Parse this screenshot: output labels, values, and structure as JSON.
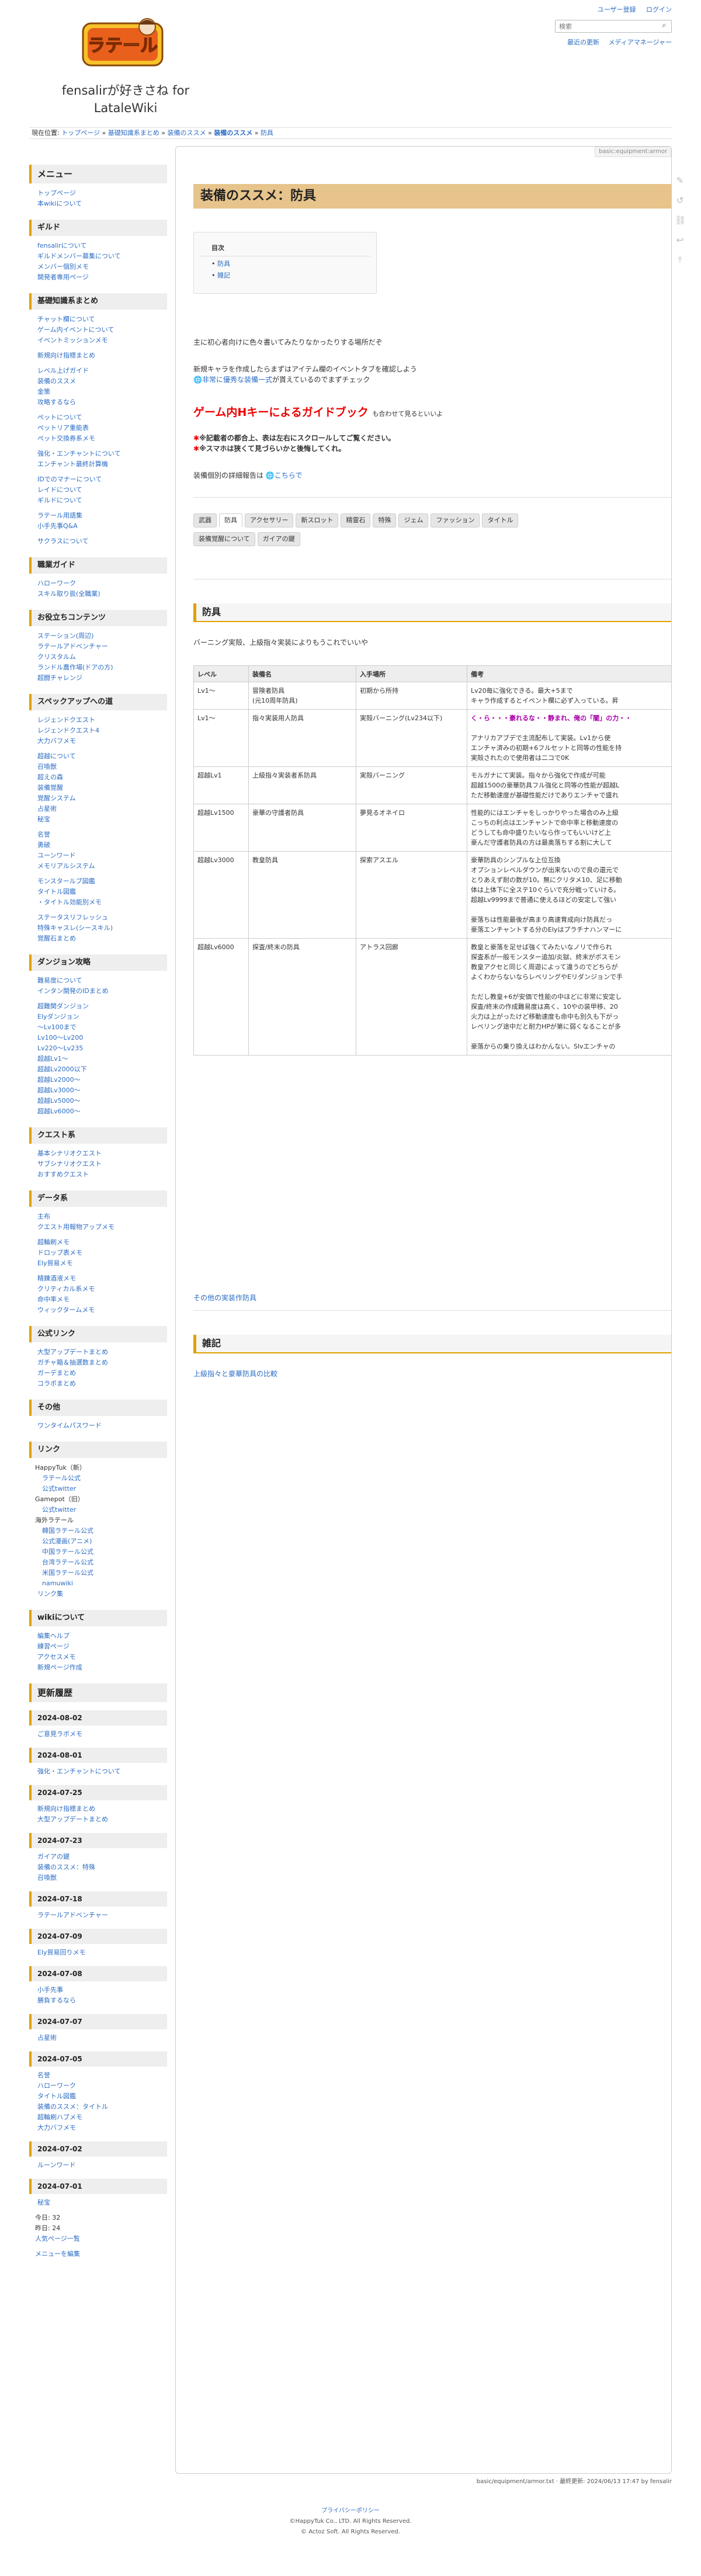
{
  "header": {
    "logo_text": "ラテール",
    "site_title": "fensalirが好きさね for LataleWiki",
    "tools": [
      "ユーザー登録",
      "ログイン"
    ],
    "search_placeholder": "検索",
    "links": [
      "最近の更新",
      "メディアマネージャー"
    ]
  },
  "breadcrumb": {
    "label": "現在位置:",
    "items": [
      "トップページ",
      "基礎知識系まとめ",
      "装備のススメ",
      "装備のススメ",
      "防具"
    ]
  },
  "page": {
    "path": "basic:equipment:armor",
    "title": "装備のススメ：防具",
    "toc": {
      "title": "目次",
      "items": [
        "防具",
        "雑記"
      ]
    },
    "intro1": "主に初心者向けに色々書いてみたりなかったりする場所だぞ",
    "intro2": "新規キャラを作成したらまずはアイテム欄のイベントタブを確認しよう",
    "intro3_link": "非常に優秀な装備一式",
    "intro3_rest": "が貰えているのでまずチェック",
    "guidebook": "ゲーム内Hキーによるガイドブック",
    "guidebook_tail": "も合わせて見るといいよ",
    "notice1": "※記載者の都合上、表は左右にスクロールしてご覧ください。",
    "notice2": "※スマホは狭くて見づらいかと後悔してくれ。",
    "details_prefix": "装備個別の詳細報告は",
    "details_link": "こちらで",
    "tabs_row1": [
      "武器",
      "防具",
      "アクセサリー",
      "新スロット",
      "精霊石",
      "特殊",
      "ジェム",
      "ファッション",
      "タイトル"
    ],
    "tabs_row2": [
      "装備覚醒について",
      "ガイアの鍵"
    ],
    "sec1_title": "防具",
    "sec1_desc": "バーニング実殻、上級指々実装によりもうこれでいいや",
    "table": {
      "headers": [
        "レベル",
        "装備名",
        "入手場所",
        "備考"
      ],
      "rows": [
        {
          "level": [
            "Lv1〜"
          ],
          "name": [
            "冒険者防具",
            "(元10周年防具)"
          ],
          "place": [
            "初期から所持"
          ],
          "note": [
            "Lv20毎に強化できる。最大+5まで",
            "キャラ作成するとイベント欄に必ず入っている。昇"
          ]
        },
        {
          "level": [
            "Lv1〜"
          ],
          "name": [
            "指々実装用人防具"
          ],
          "place": [
            "実殻バーニング(Lv234以下)"
          ],
          "note": [
            "く・ら・・・豪れるな・・静まれ、俺の「闇」の力・・",
            "",
            "アナリカアブデで主流配布して実装。Lv1から使",
            "エンチャ済みの初期+6フルセットと同等の性能を持",
            "実殻されたので使用者は二コで0K"
          ]
        },
        {
          "level": [
            "超越Lv1"
          ],
          "name": [
            "上級指々実装者系防具"
          ],
          "place": [
            "実殻バーニング"
          ],
          "note": [
            "モルガナにて実装。指々から強化で作成が可能",
            "超越1500の豪華防具フル強化と同等の性能が超越L",
            "ただ移動速度が基礎性能だけでありエンチャで盛れ"
          ]
        },
        {
          "level": [
            "超越Lv1500"
          ],
          "name": [
            "豪華の守護者防具"
          ],
          "place": [
            "夢見るオネイロ"
          ],
          "note": [
            "性能的にはエンチャをしっかりやった場合のみ上級",
            "こっちの利点はエンチャントで命中率と移動速度の",
            "どうしても命中盛りたいなら作ってもいいけど上",
            "豪んだ守護者防具の方は最奥落ちする割に大して"
          ]
        },
        {
          "level": [
            "超越Lv3000"
          ],
          "name": [
            "教皇防具"
          ],
          "place": [
            "探索アスエル"
          ],
          "note": [
            "豪華防具のシンプルな上位互換",
            "オプションレベルダウンが出来ないので良の還元で",
            "とりあえず耐の数が10。無にクリタメ10、足に移動",
            "体は上体下に全ステ10ぐらいで充分戦っていける。",
            "超越Lv9999まで普通に使えるほどの安定して強い",
            "",
            "豪落ちは性能最後が高まり高速育成向け防具だっ",
            "豪落エンチャントする分のElyはプラチナハンマーに"
          ]
        },
        {
          "level": [
            "超越Lv6000"
          ],
          "name": [
            "探査/終末の防具"
          ],
          "place": [
            "アトラス回廊"
          ],
          "note": [
            "教皇と豪落を足せば強くてみたいなノリで作られ",
            "探査系が一般モンスター追加/炎獄、終末がボスモン",
            "教皇アクセと同じく周遊によって違うのでどちらが",
            "よくわからないならレベリングやEリダンジョンで手",
            "",
            "ただし教皇+6が安価で性能の中ほどに非常に安定し",
            "探査/終末の作成難易度は高く、10やの装甲移、20",
            "火力は上がったけど移動速度も命中も別久も下がっ",
            "レベリング途中だと耐力HPが第に弱くなることが多",
            "",
            "豪落からの乗り換えはわかんない。Slvエンチャの"
          ]
        }
      ]
    },
    "sec1_more": "その他の実装作防具",
    "sec2_title": "雑記",
    "sec2_link": "上級指々と豪華防具の比較"
  },
  "sidebar": {
    "menu": {
      "title": "メニュー",
      "items": [
        "トップページ",
        "本wikiについて"
      ]
    },
    "guild": {
      "title": "ギルド",
      "items": [
        "fensalirについて",
        "ギルドメンバー募集について",
        "メンバー個別メモ",
        "開発者専用ページ"
      ]
    },
    "basics": {
      "title": "基礎知識系まとめ",
      "items": [
        "チャット欄について",
        "ゲーム内イベントについて",
        "イベントミッションメモ",
        "",
        "新規向け指標まとめ",
        "",
        "レベル上げガイド",
        "装備のススメ",
        "金策",
        "攻略するなら",
        "",
        "ペットについて",
        "ペットリア重能表",
        "ペット交換券系メモ",
        "",
        "強化・エンチャントについて",
        "エンチャント最終計算機",
        "",
        "IDでのマナーについて",
        "レイドについて",
        "ギルドについて",
        "",
        "ラテール用語集",
        "小手先事Q&A",
        "",
        "サクラスについて"
      ]
    },
    "jobs": {
      "title": "職業ガイド",
      "items": [
        "ハローワーク",
        "スキル取り扱(全職業)"
      ]
    },
    "play": {
      "title": "お役立ちコンテンツ",
      "items": [
        "ステーション(周辺)",
        "ラテールアドベンチャー",
        "クリスタルム",
        "ランドル農作場(ドアの方)",
        "超闘チャレンジ"
      ]
    },
    "specup": {
      "title": "スペックアップへの道",
      "items": [
        "レジェンドクエスト",
        "レジェンドクエスト4",
        "大力バフメモ",
        "",
        "超越について",
        "召喚獣",
        "超えの森",
        "装備覚醒",
        "覚醒システム",
        "占星術",
        "秘宝",
        "",
        "名誉",
        "勇破",
        "ユーンワード",
        "メモリアルシステム",
        "",
        "モンスタールブ図鑑",
        "タイトル図鑑",
        "・タイトル効能別メモ",
        "",
        "ステータスリフレッシュ",
        "特殊キャスレ(シースキル)",
        "覚醒石まとめ"
      ]
    },
    "dungeon": {
      "title": "ダンジョン攻略",
      "items": [
        "難易度について",
        "インタン開発のIDまとめ",
        "",
        "超難関ダンジョン",
        "Elyダンジョン",
        "〜Lv100まで",
        "Lv100〜Lv200",
        "Lv220〜Lv235",
        "超越Lv1〜",
        "超越Lv2000以下",
        "超越Lv2000〜",
        "超越Lv3000〜",
        "超越Lv5000〜",
        "超越Lv6000〜"
      ]
    },
    "quest": {
      "title": "クエスト系",
      "items": [
        "基本シナリオクエスト",
        "サブシナリオクエスト",
        "おすすめクエスト"
      ]
    },
    "data": {
      "title": "データ系",
      "items": [
        "主布",
        "クエスト用報物アップメモ",
        "",
        "超輪刷メモ",
        "ドロップ表メモ",
        "Ely貿易メモ",
        "",
        "精錬酒液メモ",
        "クリティカル系メモ",
        "命中率メモ",
        "ウィックタームメモ"
      ]
    },
    "official": {
      "title": "公式リンク",
      "items": [
        "大型アップデートまとめ",
        "ガチャ箱＆抽選数まとめ",
        "ガーデまとめ",
        "コラボまとめ"
      ]
    },
    "other": {
      "title": "その他",
      "items": [
        "ワンタイムパスワード"
      ]
    },
    "links": {
      "title": "リンク",
      "happytuk_label": "HappyTuk（新）",
      "happytuk": [
        "ラテール公式",
        "公式twitter"
      ],
      "gamepot_label": "Gamepot（旧）",
      "gamepot": [
        "公式twitter"
      ],
      "overseas_label": "海外ラテール",
      "overseas": [
        "韓国ラテール公式",
        "公式漫画(アニメ)",
        "中国ラテール公式",
        "台湾ラテール公式",
        "米国ラテール公式",
        "namuwiki"
      ],
      "tail": "リンク集"
    },
    "wiki": {
      "title": "wikiについて",
      "items": [
        "編集ヘルプ",
        "練習ページ",
        "アクセスメモ",
        "新規ページ作成"
      ]
    },
    "history": {
      "title": "更新履歴",
      "entries": [
        {
          "date": "2024-08-02",
          "items": [
            "ご意見ラボメモ"
          ]
        },
        {
          "date": "2024-08-01",
          "items": [
            "強化・エンチャントについて"
          ]
        },
        {
          "date": "2024-07-25",
          "items": [
            "新規向け指標まとめ",
            "大型アップデートまとめ"
          ]
        },
        {
          "date": "2024-07-23",
          "items": [
            "ガイアの鍵",
            "装備のススメ：特殊",
            "召喚獣"
          ]
        },
        {
          "date": "2024-07-18",
          "items": [
            "ラテールアドベンチャー"
          ]
        },
        {
          "date": "2024-07-09",
          "items": [
            "Ely貿易回りメモ"
          ]
        },
        {
          "date": "2024-07-08",
          "items": [
            "小手先事",
            "勝負するなら"
          ]
        },
        {
          "date": "2024-07-07",
          "items": [
            "占星術"
          ]
        },
        {
          "date": "2024-07-05",
          "items": [
            "名誉",
            "ハローワーク",
            "タイトル図鑑",
            "装備のススメ：タイトル",
            "超輪刷ハブメモ",
            "大力バフメモ"
          ]
        },
        {
          "date": "2024-07-02",
          "items": [
            "ルーンワード"
          ]
        },
        {
          "date": "2024-07-01",
          "items": [
            "秘宝"
          ]
        }
      ]
    },
    "counter": {
      "today": "今日: 32",
      "yesterday": "昨日: 24",
      "total": "人気ページ一覧"
    },
    "edit_menu": "メニューを編集"
  },
  "footer": {
    "path_info": "basic/equipment/armor.txt · 最終更新: 2024/06/13 17:47 by fensalir",
    "privacy": "プライバシーポリシー",
    "copy1": "©HappyTuk Co., LTD. All Rights Reserved.",
    "copy2": "© Actoz Soft. All Rights Reserved."
  }
}
